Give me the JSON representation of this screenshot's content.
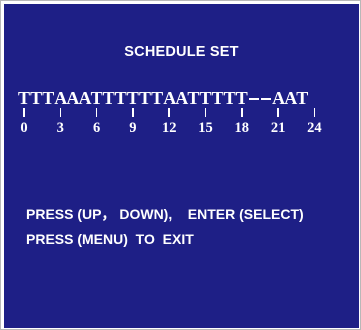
{
  "screen": {
    "title": "SCHEDULE SET",
    "background": "#1e1f86",
    "foreground": "#ffffff"
  },
  "schedule": {
    "slots": [
      "T",
      "T",
      "T",
      "A",
      "A",
      "A",
      "T",
      "T",
      "T",
      "T",
      "T",
      "T",
      "A",
      "A",
      "T",
      "T",
      "T",
      "T",
      "T",
      "-",
      "-",
      "A",
      "A",
      "T"
    ],
    "hour_labels": [
      "0",
      "3",
      "6",
      "9",
      "12",
      "15",
      "18",
      "21",
      "24"
    ]
  },
  "instructions": {
    "line_1": "PRESS (UP， DOWN),    ENTER (SELECT)",
    "line_2": "PRESS (MENU)  TO  EXIT"
  }
}
